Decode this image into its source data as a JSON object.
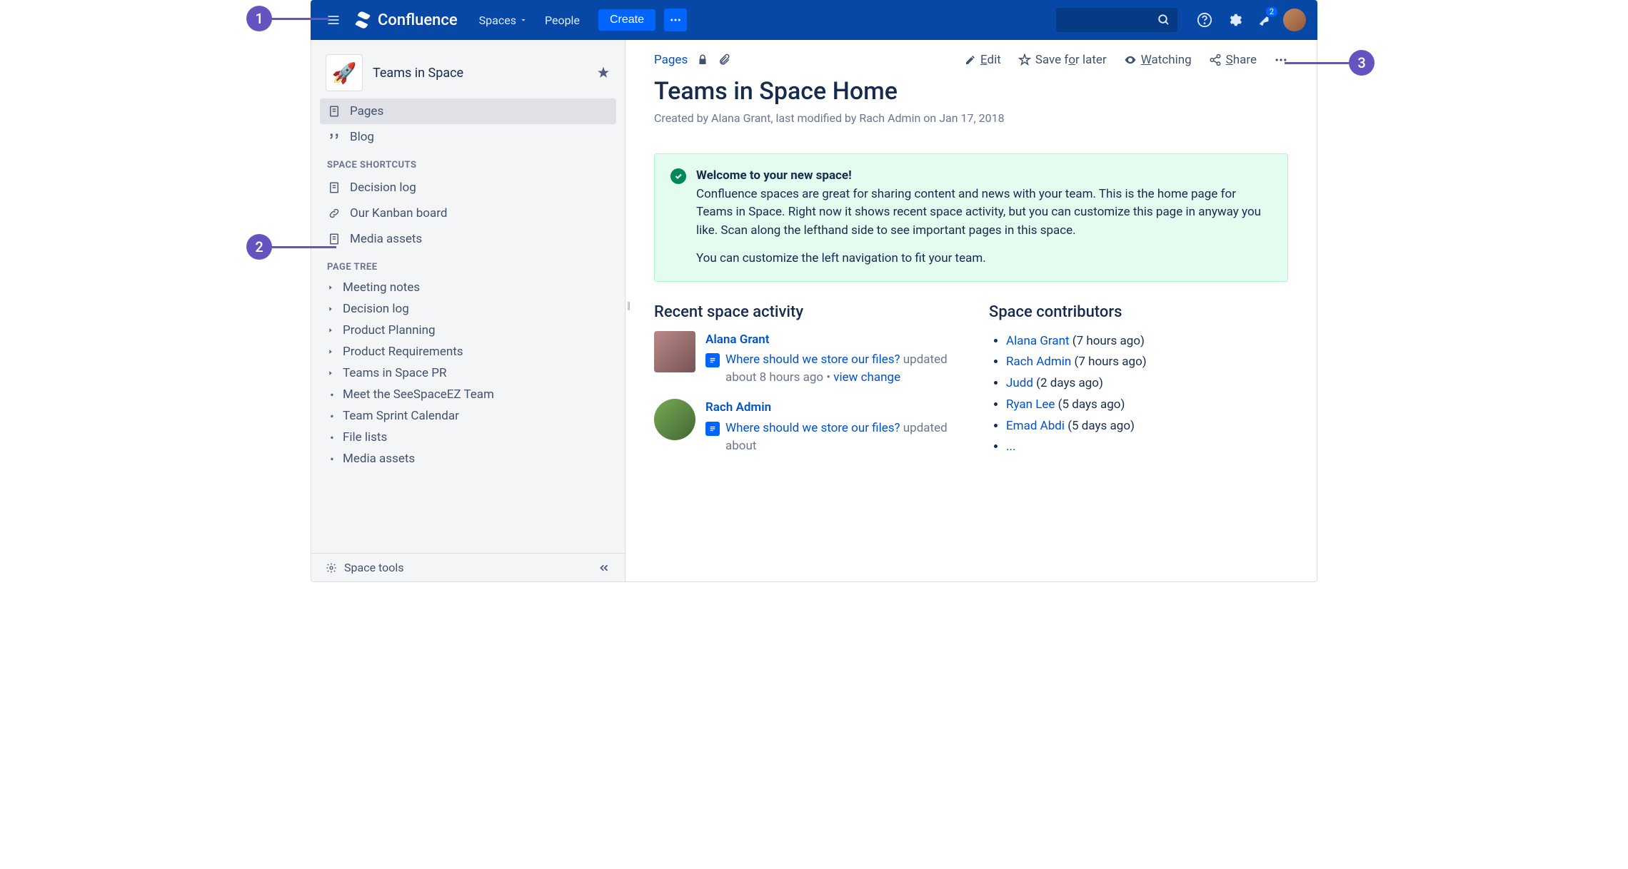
{
  "callouts": {
    "one": "1",
    "two": "2",
    "three": "3"
  },
  "topnav": {
    "product": "Confluence",
    "spaces": "Spaces",
    "people": "People",
    "create": "Create",
    "notif_count": "2"
  },
  "sidebar": {
    "space_name": "Teams in Space",
    "pages": "Pages",
    "blog": "Blog",
    "shortcuts_heading": "SPACE SHORTCUTS",
    "shortcuts": [
      {
        "icon": "page",
        "label": "Decision log"
      },
      {
        "icon": "link",
        "label": "Our Kanban board"
      },
      {
        "icon": "page",
        "label": "Media assets"
      }
    ],
    "tree_heading": "PAGE TREE",
    "tree": [
      {
        "type": "expand",
        "label": "Meeting notes"
      },
      {
        "type": "expand",
        "label": "Decision log"
      },
      {
        "type": "expand",
        "label": "Product Planning"
      },
      {
        "type": "expand",
        "label": "Product Requirements"
      },
      {
        "type": "expand",
        "label": "Teams in Space PR"
      },
      {
        "type": "leaf",
        "label": "Meet the SeeSpaceEZ Team"
      },
      {
        "type": "leaf",
        "label": "Team Sprint Calendar"
      },
      {
        "type": "leaf",
        "label": "File lists"
      },
      {
        "type": "leaf",
        "label": "Media assets"
      }
    ],
    "space_tools": "Space tools"
  },
  "toolbar": {
    "pages": "Pages",
    "edit": "Edit",
    "edit_u": "E",
    "edit_rest": "dit",
    "save": "Save for later",
    "save_pre": "Save f",
    "save_u": "o",
    "save_post": "r later",
    "watching": "Watching",
    "watch_u": "W",
    "watch_rest": "atching",
    "share": "Share",
    "share_u": "S",
    "share_rest": "hare"
  },
  "page": {
    "title": "Teams in Space Home",
    "meta": "Created by Alana Grant, last modified by Rach Admin on Jan 17, 2018"
  },
  "info": {
    "title": "Welcome to your new space!",
    "body": "Confluence spaces are great for sharing content and news with your team. This is the home page for Teams in Space. Right now it shows recent space activity, but you can customize this page in anyway you like. Scan along the lefthand side to see important pages in this space.",
    "body2": "You can customize the left navigation to fit your team."
  },
  "activity": {
    "heading": "Recent space activity",
    "items": [
      {
        "user": "Alana Grant",
        "link": "Where should we store our files?",
        "meta": "updated about 8 hours ago",
        "change": "view change",
        "avatar_shape": "square",
        "avatar_bg": "linear-gradient(135deg,#b88,#755)"
      },
      {
        "user": "Rach Admin",
        "link": "Where should we store our files?",
        "meta": "updated about",
        "change": "",
        "avatar_shape": "round",
        "avatar_bg": "linear-gradient(135deg,#7a5,#463)"
      }
    ]
  },
  "contributors": {
    "heading": "Space contributors",
    "items": [
      {
        "name": "Alana Grant",
        "ago": "(7 hours ago)"
      },
      {
        "name": "Rach Admin",
        "ago": "(7 hours ago)"
      },
      {
        "name": "Judd",
        "ago": "(2 days ago)"
      },
      {
        "name": "Ryan Lee",
        "ago": "(5 days ago)"
      },
      {
        "name": "Emad Abdi",
        "ago": "(5 days ago)"
      }
    ],
    "more": "..."
  }
}
